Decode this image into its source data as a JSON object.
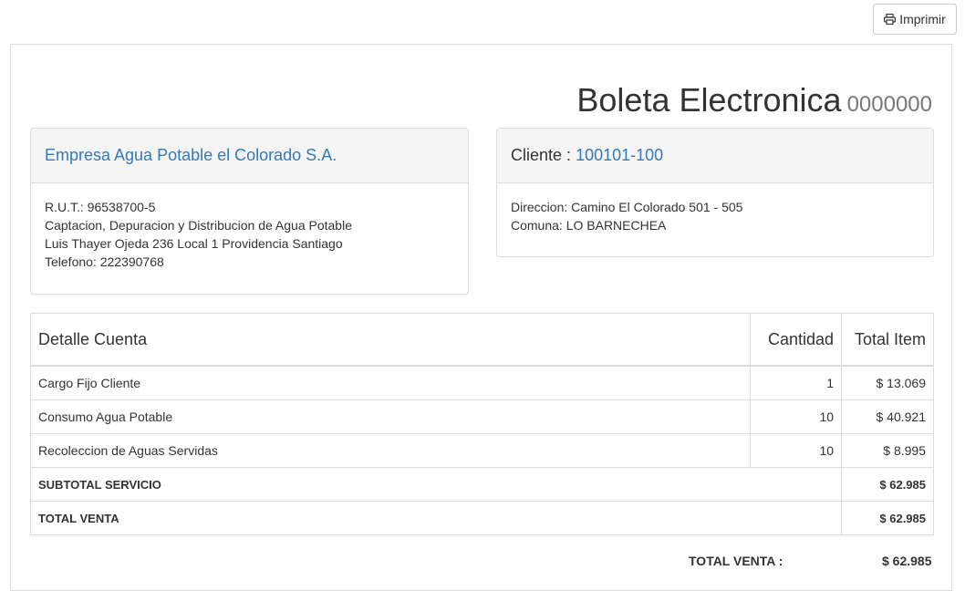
{
  "toolbar": {
    "print_label": "Imprimir"
  },
  "invoice": {
    "title": "Boleta Electronica",
    "number": "0000000"
  },
  "company": {
    "name": "Empresa Agua Potable el Colorado S.A.",
    "lines": [
      "R.U.T.: 96538700-5",
      "Captacion, Depuracion y Distribucion de Agua Potable",
      "Luis Thayer Ojeda 236 Local 1 Providencia Santiago",
      "Telefono: 222390768"
    ]
  },
  "client": {
    "label": "Cliente :",
    "id": "100101-100",
    "lines": [
      "Direccion: Camino El Colorado 501 - 505",
      "Comuna: LO BARNECHEA"
    ]
  },
  "table": {
    "headers": [
      "Detalle Cuenta",
      "Cantidad",
      "Total Item"
    ],
    "rows": [
      {
        "detail": "Cargo Fijo Cliente",
        "qty": "1",
        "total": "$ 13.069"
      },
      {
        "detail": "Consumo Agua Potable",
        "qty": "10",
        "total": "$ 40.921"
      },
      {
        "detail": "Recoleccion de Aguas Servidas",
        "qty": "10",
        "total": "$ 8.995"
      }
    ],
    "subtotal": {
      "label": "SUBTOTAL SERVICIO",
      "value": "$ 62.985"
    },
    "total": {
      "label": "TOTAL VENTA",
      "value": "$ 62.985"
    }
  },
  "summary": {
    "label": "TOTAL VENTA :",
    "value": "$ 62.985"
  }
}
